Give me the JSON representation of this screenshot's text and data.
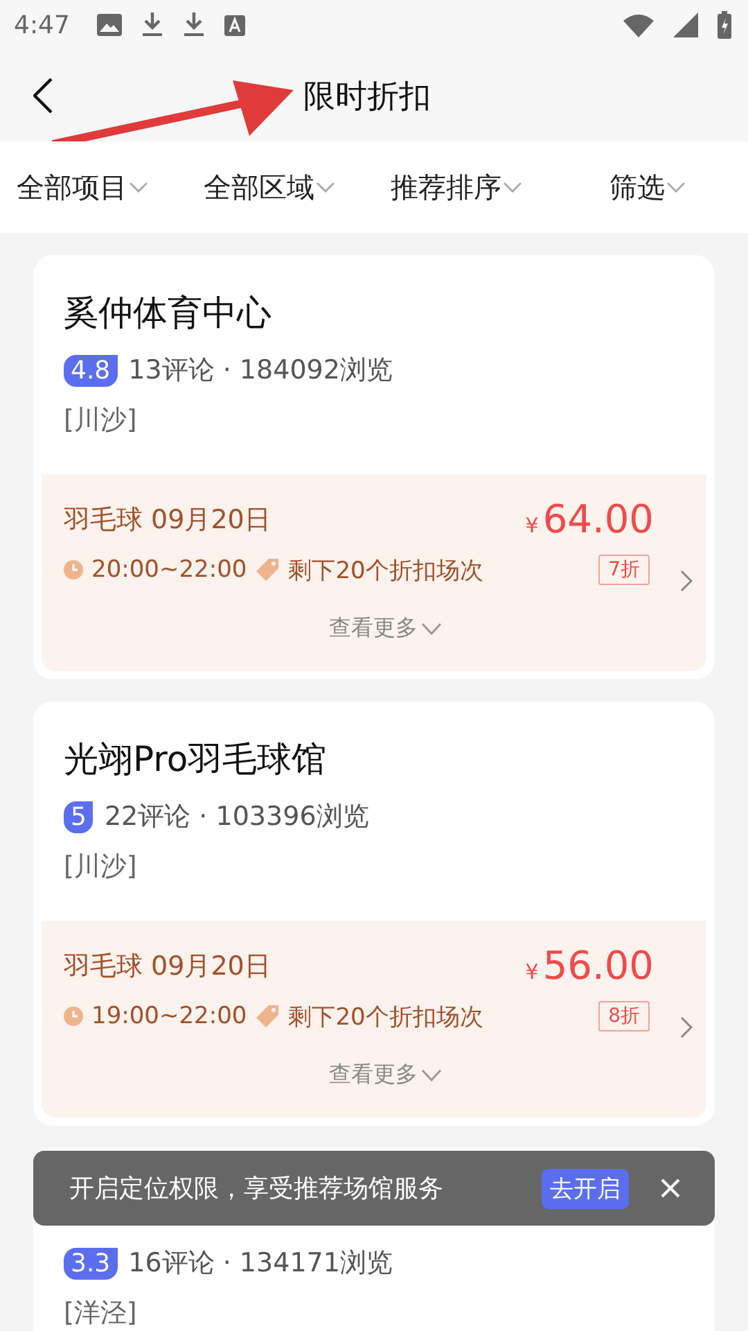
{
  "status_bar": {
    "time": "4:47"
  },
  "header": {
    "title": "限时折扣"
  },
  "filters": [
    {
      "label": "全部项目"
    },
    {
      "label": "全部区域"
    },
    {
      "label": "推荐排序"
    },
    {
      "label": "筛选"
    }
  ],
  "venues": [
    {
      "name": "奚仲体育中心",
      "rating": "4.8",
      "stats": "13评论 · 184092浏览",
      "area": "[川沙]",
      "deal": {
        "sport_date": "羽毛球 09月20日",
        "currency": "¥",
        "price": "64.00",
        "time": "20:00~22:00",
        "remaining": "剩下20个折扣场次",
        "discount": "7折",
        "more": "查看更多"
      }
    },
    {
      "name": "光翊Pro羽毛球馆",
      "rating": "5",
      "stats": "22评论 · 103396浏览",
      "area": "[川沙]",
      "deal": {
        "sport_date": "羽毛球 09月20日",
        "currency": "¥",
        "price": "56.00",
        "time": "19:00~22:00",
        "remaining": "剩下20个折扣场次",
        "discount": "8折",
        "more": "查看更多"
      }
    },
    {
      "rating": "3.3",
      "stats": "16评论 · 134171浏览",
      "area": "[洋泾]"
    }
  ],
  "toast": {
    "message": "开启定位权限，享受推荐场馆服务",
    "action": "去开启"
  }
}
